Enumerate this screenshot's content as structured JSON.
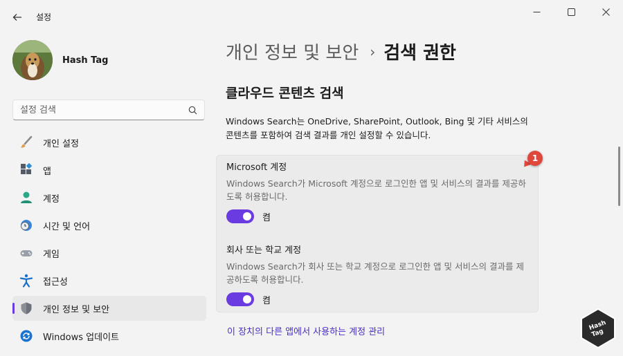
{
  "window": {
    "title": "설정",
    "controls": {
      "minimize": "—",
      "maximize": "☐",
      "close": "✕"
    }
  },
  "profile": {
    "name": "Hash Tag"
  },
  "search": {
    "placeholder": "설정 검색"
  },
  "sidebar": {
    "items": [
      {
        "label": "개인 설정",
        "icon": "brush-icon"
      },
      {
        "label": "앱",
        "icon": "apps-icon"
      },
      {
        "label": "계정",
        "icon": "account-icon"
      },
      {
        "label": "시간 및 언어",
        "icon": "clock-globe-icon"
      },
      {
        "label": "게임",
        "icon": "gamepad-icon"
      },
      {
        "label": "접근성",
        "icon": "accessibility-icon"
      },
      {
        "label": "개인 정보 및 보안",
        "icon": "shield-icon",
        "active": true
      },
      {
        "label": "Windows 업데이트",
        "icon": "update-icon"
      }
    ]
  },
  "breadcrumb": {
    "parent": "개인 정보 및 보안",
    "separator": "›",
    "current": "검색 권한"
  },
  "section": {
    "title": "클라우드 콘텐츠 검색",
    "description": "Windows Search는 OneDrive, SharePoint, Outlook, Bing 및 기타 서비스의 콘텐츠를 포함하여 검색 결과를 개인 설정할 수 있습니다."
  },
  "card": {
    "items": [
      {
        "title": "Microsoft 계정",
        "description": "Windows Search가 Microsoft 계정으로 로그인한 앱 및 서비스의 결과를 제공하도록 허용합니다.",
        "toggle_label": "켬",
        "on": true
      },
      {
        "title": "회사 또는 학교 계정",
        "description": "Windows Search가 회사 또는 학교 계정으로 로그인한 앱 및 서비스의 결과를 제공하도록 허용합니다.",
        "toggle_label": "켬",
        "on": true
      }
    ]
  },
  "annotation": {
    "number": "1"
  },
  "link": {
    "label": "이 장치의 다른 앱에서 사용하는 계정 관리"
  },
  "watermark": {
    "text": "Hash Tag"
  },
  "colors": {
    "accent": "#6a3be0",
    "badge": "#e0473c",
    "link": "#4b2cc9",
    "background": "#f3f3f3"
  }
}
